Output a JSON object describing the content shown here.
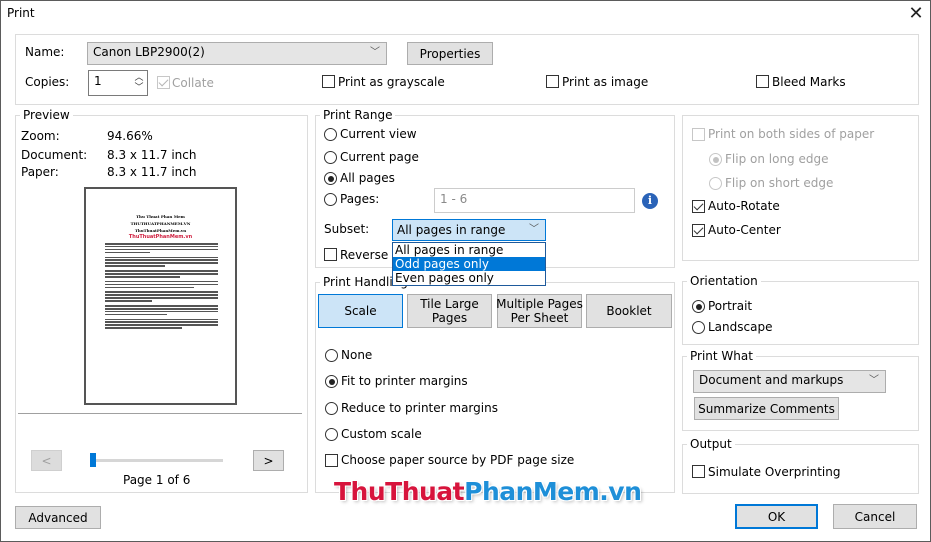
{
  "window": {
    "title": "Print",
    "close_icon": "close-icon"
  },
  "printer": {
    "name_label": "Name:",
    "name_value": "Canon LBP2900(2)",
    "properties_label": "Properties",
    "copies_label": "Copies:",
    "copies_value": "1",
    "collate_label": "Collate",
    "collate_checked": true,
    "grayscale_label": "Print as grayscale",
    "image_label": "Print as image",
    "bleed_label": "Bleed Marks"
  },
  "preview": {
    "legend": "Preview",
    "zoom_label": "Zoom:",
    "zoom_value": "94.66%",
    "document_label": "Document:",
    "document_value": "8.3 x 11.7 inch",
    "paper_label": "Paper:",
    "paper_value": "8.3 x 11.7 inch",
    "page_title_1": "Thu Thuat Phan Mem",
    "page_title_2": "THUTHUATPHANMEM.VN",
    "page_title_3": "ThuThuatPhanMem.vn",
    "page_logo": "ThuThuatPhanMem.vn",
    "prev_label": "<",
    "next_label": ">",
    "page_indicator": "Page 1 of 6",
    "current_page": 1,
    "total_pages": 6
  },
  "print_range": {
    "legend": "Print Range",
    "options": [
      {
        "label": "Current view",
        "checked": false
      },
      {
        "label": "Current page",
        "checked": false
      },
      {
        "label": "All pages",
        "checked": true
      },
      {
        "label": "Pages:",
        "checked": false
      }
    ],
    "pages_value": "1 - 6",
    "subset_label": "Subset:",
    "subset_value": "All pages in range",
    "subset_options": [
      "All pages in range",
      "Odd pages only",
      "Even pages only"
    ],
    "subset_highlighted": "Odd pages only",
    "reverse_label": "Reverse pages"
  },
  "print_handling": {
    "legend": "Print Handling",
    "tabs": [
      "Scale",
      "Tile Large Pages",
      "Multiple Pages Per Sheet",
      "Booklet"
    ],
    "tab_lines": [
      [
        "Scale"
      ],
      [
        "Tile Large",
        "Pages"
      ],
      [
        "Multiple Pages",
        "Per Sheet"
      ],
      [
        "Booklet"
      ]
    ],
    "selected_tab": "Scale",
    "options": [
      {
        "label": "None",
        "checked": false
      },
      {
        "label": "Fit to printer margins",
        "checked": true
      },
      {
        "label": "Reduce to printer margins",
        "checked": false
      },
      {
        "label": "Custom scale",
        "checked": false
      }
    ],
    "paper_source_label": "Choose paper source by PDF page size"
  },
  "duplex": {
    "both_sides_label": "Print on both sides of paper",
    "long_edge_label": "Flip on long edge",
    "short_edge_label": "Flip on short edge",
    "auto_rotate_label": "Auto-Rotate",
    "auto_center_label": "Auto-Center"
  },
  "orientation": {
    "legend": "Orientation",
    "portrait_label": "Portrait",
    "landscape_label": "Landscape",
    "selected": "Portrait"
  },
  "print_what": {
    "legend": "Print What",
    "value": "Document and markups",
    "summarize_label": "Summarize Comments"
  },
  "output": {
    "legend": "Output",
    "simulate_label": "Simulate Overprinting"
  },
  "footer": {
    "advanced_label": "Advanced",
    "ok_label": "OK",
    "cancel_label": "Cancel"
  },
  "watermark": {
    "part1": "ThuThuat",
    "part2": "PhanMem.vn",
    "color1": "#d7143c",
    "color2": "#1e8fd8"
  }
}
